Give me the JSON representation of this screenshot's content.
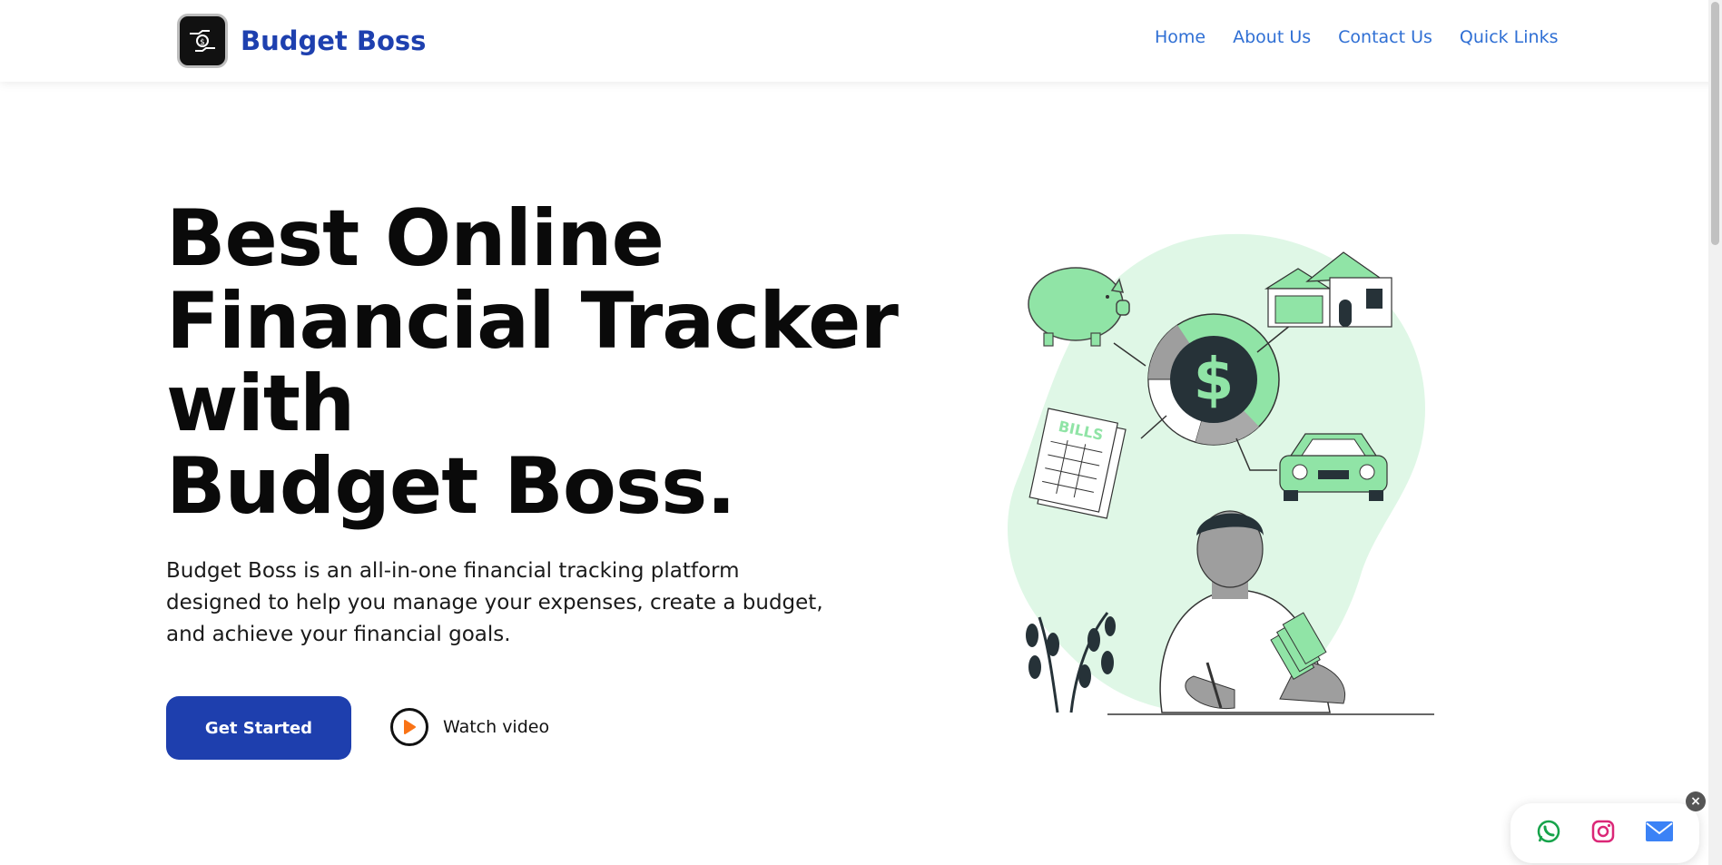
{
  "header": {
    "brand_name": "Budget Boss",
    "logo_icon": "hand-money-logo-icon",
    "nav": [
      {
        "label": "Home"
      },
      {
        "label": "About Us"
      },
      {
        "label": "Contact Us"
      },
      {
        "label": "Quick Links"
      }
    ]
  },
  "hero": {
    "title_lines": [
      "Best Online",
      "Financial Tracker",
      "with"
    ],
    "title_highlight": "Budget Boss.",
    "description": "Budget Boss is an all-in-one financial tracking platform designed to help you manage your expenses, create a budget, and achieve your financial goals.",
    "cta_label": "Get Started",
    "watch_label": "Watch video"
  },
  "illustration": {
    "bills_label": "BILLS",
    "dollar_sign": "$"
  },
  "social": {
    "icons": [
      "whatsapp-icon",
      "instagram-icon",
      "email-icon"
    ],
    "close": "×"
  },
  "colors": {
    "brand": "#1e40af",
    "nav": "#2f6fd4",
    "accent_green": "#4ade80",
    "cta": "#1e3fae",
    "play_orange": "#f97316"
  }
}
